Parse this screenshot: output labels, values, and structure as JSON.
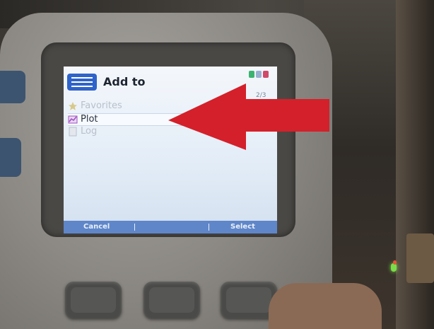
{
  "screen": {
    "title": "Add to",
    "page_indicator": "2/3",
    "menu_items": [
      {
        "label": "Favorites",
        "icon": "star-icon",
        "state": "disabled"
      },
      {
        "label": "Plot",
        "icon": "plot-icon",
        "state": "selected"
      },
      {
        "label": "Log",
        "icon": "log-icon",
        "state": "disabled"
      }
    ],
    "softkeys": {
      "left": "Cancel",
      "right": "Select"
    }
  },
  "colors": {
    "accent_blue": "#2f63c9",
    "softkey_bar": "#5f86c8",
    "arrow_red": "#d4202a"
  }
}
